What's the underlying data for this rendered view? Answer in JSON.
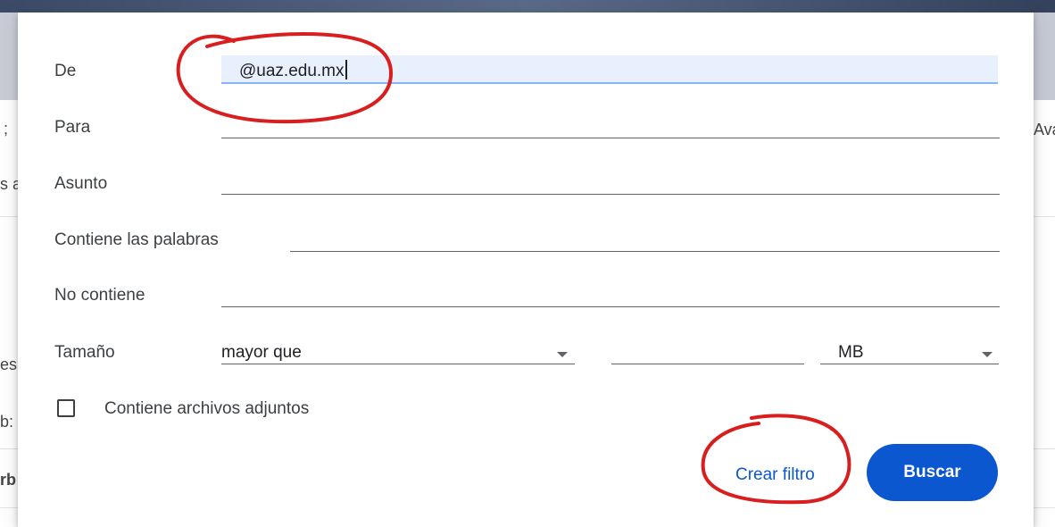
{
  "background": {
    "fragments": [
      ";",
      "s a",
      "es",
      "b:",
      "rb",
      "Ava"
    ]
  },
  "dialog": {
    "from": {
      "label": "De",
      "value": "@uaz.edu.mx"
    },
    "to": {
      "label": "Para",
      "value": ""
    },
    "subject": {
      "label": "Asunto",
      "value": ""
    },
    "has_words": {
      "label": "Contiene las palabras",
      "value": ""
    },
    "doesnt_have": {
      "label": "No contiene",
      "value": ""
    },
    "size": {
      "label": "Tamaño",
      "operator": "mayor que",
      "value": "",
      "unit": "MB"
    },
    "attachments": {
      "label": "Contiene archivos adjuntos",
      "checked": false
    },
    "create_filter_label": "Crear filtro",
    "search_label": "Buscar"
  },
  "annotations": {
    "color": "#d81e1e"
  },
  "colors": {
    "primary": "#0b57d0",
    "active_field": "#e8f0fe"
  }
}
